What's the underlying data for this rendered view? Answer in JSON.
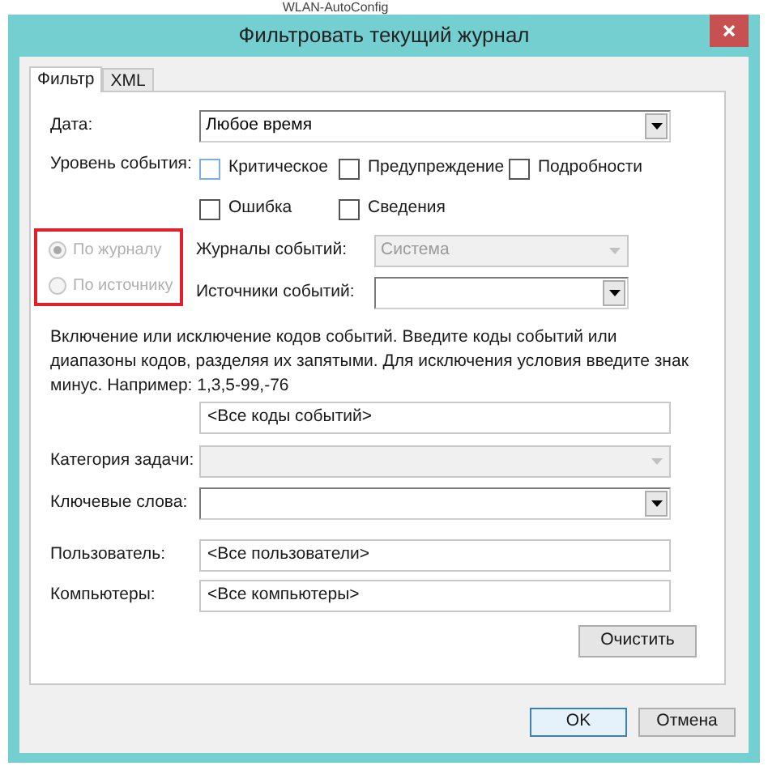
{
  "background_text": "WLAN-AutoConfig",
  "window": {
    "title": "Фильтровать текущий журнал"
  },
  "tabs": [
    {
      "label": "Фильтр",
      "selected": true
    },
    {
      "label": "XML",
      "selected": false
    }
  ],
  "date": {
    "label": "Дата:",
    "value": "Любое время"
  },
  "event_level": {
    "label": "Уровень события:",
    "options": [
      {
        "label": "Критическое",
        "checked": false
      },
      {
        "label": "Предупреждение",
        "checked": false
      },
      {
        "label": "Подробности",
        "checked": false
      },
      {
        "label": "Ошибка",
        "checked": false
      },
      {
        "label": "Сведения",
        "checked": false
      }
    ]
  },
  "source_mode": [
    {
      "label": "По журналу",
      "selected": true,
      "disabled": true
    },
    {
      "label": "По источнику",
      "selected": false,
      "disabled": true
    }
  ],
  "event_logs": {
    "label": "Журналы событий:",
    "value": "Система",
    "disabled": true
  },
  "event_sources": {
    "label": "Источники событий:",
    "disabled": false
  },
  "event_ids": {
    "description": "Включение или исключение кодов событий. Введите коды событий или диапазоны кодов, разделяя их запятыми. Для исключения условия введите знак минус. Например: 1,3,5-99,-76",
    "value": "<Все коды событий>"
  },
  "task_category": {
    "label": "Категория задачи:",
    "disabled": true
  },
  "keywords": {
    "label": "Ключевые слова:",
    "disabled": false
  },
  "user": {
    "label": "Пользователь:",
    "value": "<Все пользователи>"
  },
  "computers": {
    "label": "Компьютеры:",
    "value": "<Все компьютеры>"
  },
  "buttons": {
    "clear": "Очистить",
    "ok": "OK",
    "cancel": "Отмена"
  }
}
